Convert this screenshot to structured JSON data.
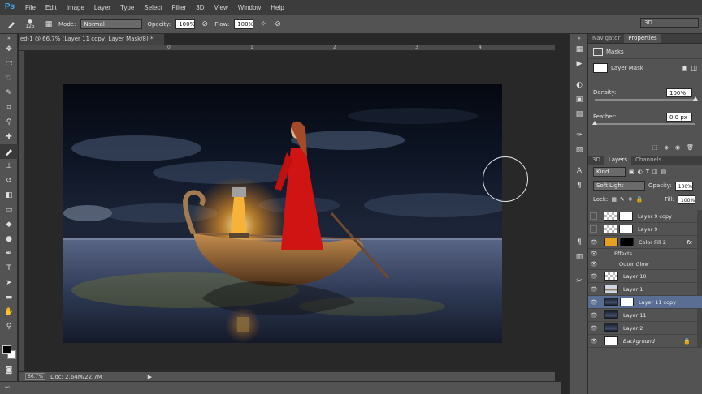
{
  "app": {
    "logo": "Ps"
  },
  "menu": [
    "File",
    "Edit",
    "Image",
    "Layer",
    "Type",
    "Select",
    "Filter",
    "3D",
    "View",
    "Window",
    "Help"
  ],
  "workspace": "3D",
  "options": {
    "brush_size": "125",
    "mode_label": "Mode:",
    "mode_value": "Normal",
    "opacity_label": "Opacity:",
    "opacity_value": "100%",
    "flow_label": "Flow:",
    "flow_value": "100%"
  },
  "document": {
    "tab_title": "ed-1 @ 66.7% (Layer 11 copy, Layer Mask/8) *",
    "ruler_marks": [
      "0",
      "1",
      "2",
      "3",
      "4"
    ],
    "zoom": "66.7%",
    "doc_size": "Doc: 2.64M/22.7M"
  },
  "properties": {
    "tabs": [
      "Navigator",
      "Properties"
    ],
    "active_tab": "Properties",
    "section_title": "Masks",
    "mask_label": "Layer Mask",
    "density_label": "Density:",
    "density_value": "100%",
    "density_level": 1.0,
    "feather_label": "Feather:",
    "feather_value": "0.0 px",
    "feather_level": 0.0
  },
  "layers_panel": {
    "tabs": [
      "3D",
      "Layers",
      "Channels"
    ],
    "active_tab": "Layers",
    "filter_kind": "Kind",
    "blend_mode": "Soft Light",
    "opacity_label": "Opacity:",
    "opacity_value": "100%",
    "lock_label": "Lock:",
    "fill_label": "Fill:",
    "fill_value": "100%",
    "layers": [
      {
        "name": "Layer 9 copy",
        "visible": false,
        "thumb": "checker",
        "mask": true
      },
      {
        "name": "Layer 9",
        "visible": false,
        "thumb": "checker",
        "mask": true
      },
      {
        "name": "Color Fill 2",
        "visible": true,
        "thumb": "orange",
        "mask": true,
        "mask_color": "#000000",
        "fx": "fx"
      },
      {
        "name": "Effects",
        "visible": true,
        "sub": true
      },
      {
        "name": "Outer Glow",
        "visible": true,
        "sub": true,
        "indent": 2
      },
      {
        "name": "Layer 10",
        "visible": true,
        "thumb": "checker"
      },
      {
        "name": "Layer 1",
        "visible": true,
        "thumb": "boat"
      },
      {
        "name": "Layer 11 copy",
        "visible": true,
        "thumb": "sky",
        "mask": true,
        "selected": true
      },
      {
        "name": "Layer 11",
        "visible": true,
        "thumb": "sky"
      },
      {
        "name": "Layer 2",
        "visible": true,
        "thumb": "sky"
      },
      {
        "name": "Background",
        "visible": true,
        "thumb": "white",
        "locked": true,
        "italic": true
      }
    ]
  },
  "colors": {
    "accent": "#3ea8f5",
    "selection": "#5a6e94",
    "lantern": "#f7b23a",
    "dress": "#d01414",
    "color_fill": "#e8a020"
  }
}
